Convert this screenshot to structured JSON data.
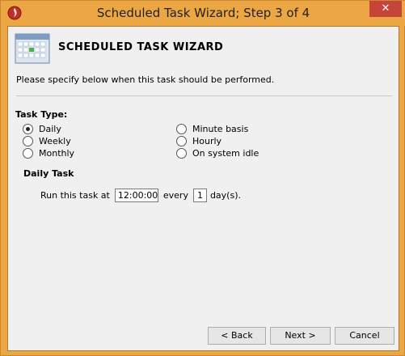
{
  "window": {
    "title": "Scheduled Task Wizard; Step 3 of 4",
    "close_label": "✕"
  },
  "header": {
    "title": "SCHEDULED TASK WIZARD"
  },
  "instruction": "Please specify below when this task should be performed.",
  "task_type": {
    "label": "Task Type:",
    "options": [
      {
        "label": "Daily",
        "checked": true
      },
      {
        "label": "Weekly",
        "checked": false
      },
      {
        "label": "Monthly",
        "checked": false
      },
      {
        "label": "Minute basis",
        "checked": false
      },
      {
        "label": "Hourly",
        "checked": false
      },
      {
        "label": "On system idle",
        "checked": false
      }
    ]
  },
  "daily_task": {
    "label": "Daily Task",
    "run_prefix": "Run this task at",
    "time_value": "12:00:00",
    "every_label": "every",
    "every_value": "1",
    "days_label": "day(s)."
  },
  "buttons": {
    "back": "< Back",
    "next": "Next >",
    "cancel": "Cancel"
  },
  "colors": {
    "frame": "#eda644",
    "client_bg": "#f0f0f0",
    "close_button": "#c7443a"
  },
  "icons": {
    "app": "flame-shield-icon",
    "header": "calendar-icon"
  }
}
